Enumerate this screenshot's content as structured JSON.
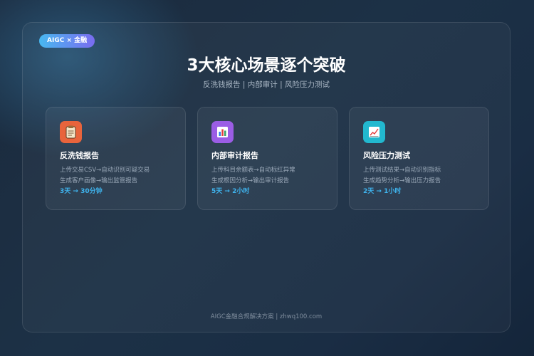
{
  "badge": "AIGC × 金融",
  "title": "3大核心场景逐个突破",
  "subtitle": "反洗钱报告 | 内部审计 | 风险压力测试",
  "features": [
    {
      "icon": "clipboard-icon",
      "icon_color": "#e8643c",
      "title": "反洗钱报告",
      "line1": "上传交易CSV→自动识别可疑交易",
      "line2": "生成客户画像→输出监管报告",
      "result": "3天 → 30分钟"
    },
    {
      "icon": "bar-chart-icon",
      "icon_color": "#9b5de5",
      "title": "内部审计报告",
      "line1": "上传科目余额表→自动标红异常",
      "line2": "生成根因分析→输出审计报告",
      "result": "5天 → 2小时"
    },
    {
      "icon": "trend-chart-icon",
      "icon_color": "#22b8cf",
      "title": "风险压力测试",
      "line1": "上传测试结果→自动识别指标",
      "line2": "生成趋势分析→输出压力报告",
      "result": "2天 → 1小时"
    }
  ],
  "footer": "AIGC金融合规解决方案 | zhwq100.com",
  "colors": {
    "accent": "#3fb4ee",
    "badge_gradient": [
      "#48b8f0",
      "#7a6cf0"
    ]
  }
}
